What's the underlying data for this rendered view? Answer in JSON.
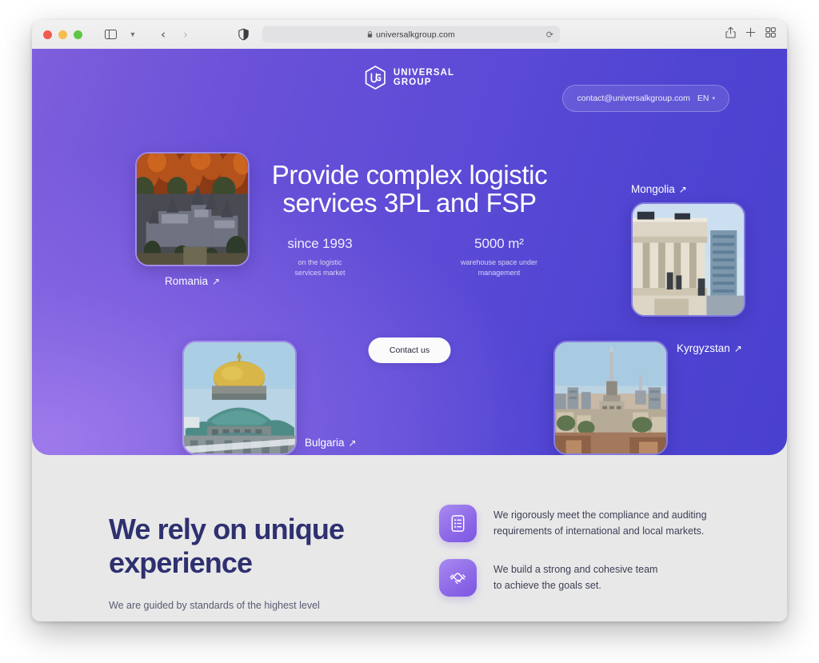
{
  "browser": {
    "url": "universalkgroup.com",
    "lock_icon": "lock-icon",
    "reload_icon": "reload-icon",
    "sidebar_icon": "sidebar-icon",
    "tab_dropdown_icon": "chevron-down-icon",
    "back_icon": "chevron-left-icon",
    "forward_icon": "chevron-right-icon",
    "shield_icon": "shield-privacy-icon",
    "share_icon": "share-icon",
    "new_tab_icon": "plus-icon",
    "tab_overview_icon": "tab-overview-icon",
    "traffic_lights": [
      "close-red",
      "minimize-yellow",
      "maximize-green"
    ]
  },
  "hero": {
    "logo": {
      "line1": "UNIVERSAL",
      "line2": "GROUP",
      "mark": "hexagon-ug-icon"
    },
    "contact_email": "contact@universalkgroup.com",
    "language": "EN",
    "language_caret": "▾",
    "headline_line1": "Provide complex logistic",
    "headline_line2": "services 3PL and FSP",
    "stats": [
      {
        "value": "since 1993",
        "label_line1": "on the logistic",
        "label_line2": "services market"
      },
      {
        "value": "5000 m²",
        "label_line1": "warehouse space under",
        "label_line2": "management"
      }
    ],
    "cta_label": "Contact us",
    "destinations": [
      {
        "name": "Romania",
        "arrow": "↗",
        "photo": "peles-castle-autumn"
      },
      {
        "name": "Mongolia",
        "arrow": "↗",
        "photo": "ulaanbaatar-government-palace"
      },
      {
        "name": "Bulgaria",
        "arrow": "↗",
        "photo": "alexander-nevsky-cathedral"
      },
      {
        "name": "Kyrgyzstan",
        "arrow": "↗",
        "photo": "bishkek-cityscape-tower"
      }
    ]
  },
  "section": {
    "title_line1": "We rely on unique",
    "title_line2": "experience",
    "paragraph": "We are guided by standards of the highest level",
    "features": [
      {
        "icon": "checklist-document-icon",
        "line1": "We rigorously meet the compliance and auditing",
        "line2": "requirements of international and local markets."
      },
      {
        "icon": "handshake-team-icon",
        "line1": "We build a strong and cohesive team",
        "line2": "to achieve the goals set."
      }
    ]
  },
  "colors": {
    "hero_gradient_start": "#7e5fdc",
    "hero_gradient_end": "#4a40cf",
    "page_background": "#e8e8e8",
    "heading_navy": "#2e3070",
    "cta_background": "#fbfbfc"
  }
}
